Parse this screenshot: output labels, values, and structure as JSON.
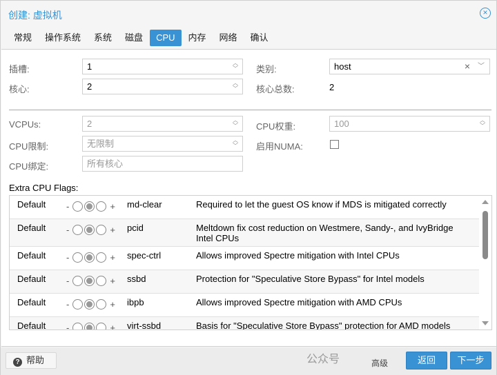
{
  "window": {
    "title": "创建: 虚拟机",
    "close_icon": "×"
  },
  "tabs": [
    {
      "label": "常规",
      "active": false
    },
    {
      "label": "操作系统",
      "active": false
    },
    {
      "label": "系统",
      "active": false
    },
    {
      "label": "磁盘",
      "active": false
    },
    {
      "label": "CPU",
      "active": true
    },
    {
      "label": "内存",
      "active": false
    },
    {
      "label": "网络",
      "active": false
    },
    {
      "label": "确认",
      "active": false
    }
  ],
  "form": {
    "sockets": {
      "label": "插槽:",
      "value": "1"
    },
    "cores": {
      "label": "核心:",
      "value": "2"
    },
    "type": {
      "label": "类别:",
      "value": "host"
    },
    "total_cores": {
      "label": "核心总数:",
      "value": "2"
    },
    "vcpus": {
      "label": "VCPUs:",
      "value": "2"
    },
    "cpu_limit": {
      "label": "CPU限制:",
      "placeholder": "无限制"
    },
    "cpu_affinity": {
      "label": "CPU绑定:",
      "placeholder": "所有核心"
    },
    "cpu_units": {
      "label": "CPU权重:",
      "value": "100"
    },
    "numa": {
      "label": "启用NUMA:",
      "checked": false
    }
  },
  "flags": {
    "label": "Extra CPU Flags:",
    "rows": [
      {
        "state": "Default",
        "flag": "md-clear",
        "description": "Required to let the guest OS know if MDS is mitigated correctly"
      },
      {
        "state": "Default",
        "flag": "pcid",
        "description": "Meltdown fix cost reduction on Westmere, Sandy-, and IvyBridge Intel CPUs"
      },
      {
        "state": "Default",
        "flag": "spec-ctrl",
        "description": "Allows improved Spectre mitigation with Intel CPUs"
      },
      {
        "state": "Default",
        "flag": "ssbd",
        "description": "Protection for \"Speculative Store Bypass\" for Intel models"
      },
      {
        "state": "Default",
        "flag": "ibpb",
        "description": "Allows improved Spectre mitigation with AMD CPUs"
      },
      {
        "state": "Default",
        "flag": "virt-ssbd",
        "description": "Basis for \"Speculative Store Bypass\" protection for AMD models"
      }
    ],
    "minus": "-",
    "plus": "+"
  },
  "footer": {
    "help_label": "帮助",
    "help_icon": "?",
    "advanced_label": "高级",
    "back_label": "返回",
    "next_label": "下一步"
  },
  "watermark": "公众号"
}
